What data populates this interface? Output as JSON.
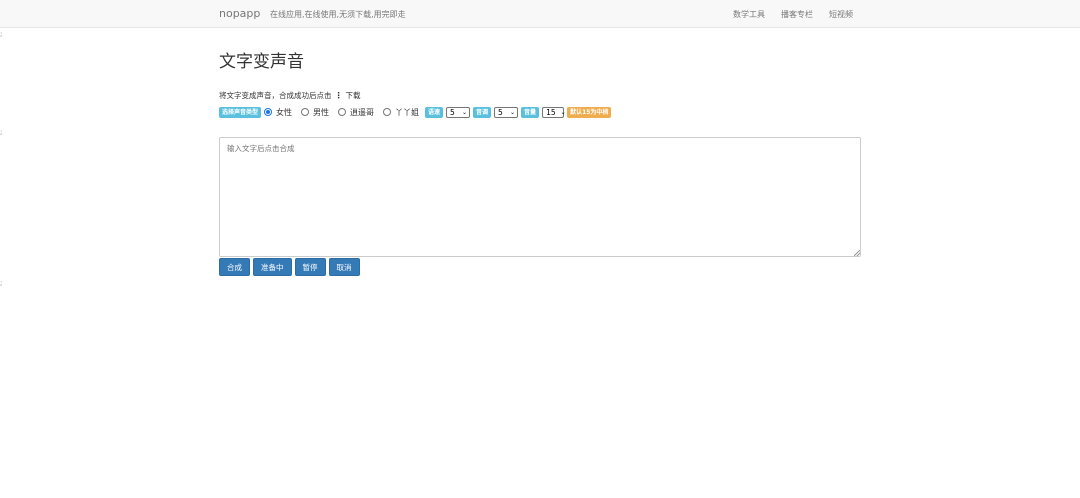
{
  "navbar": {
    "brand": "nopapp",
    "tagline": "在线应用,在线使用,无须下载,用完即走",
    "links": [
      "数学工具",
      "播客专栏",
      "短视频"
    ]
  },
  "edge_marks": [
    ";",
    ";",
    ";"
  ],
  "page": {
    "title": "文字变声音",
    "description_before": "将文字变成声音，合成成功后点击",
    "download_icon": "download-icon",
    "description_after": "下载"
  },
  "options": {
    "voice_type_label": "选择声音类型",
    "voices": [
      {
        "label": "女性",
        "checked": true
      },
      {
        "label": "男性",
        "checked": false
      },
      {
        "label": "逍遥哥",
        "checked": false
      },
      {
        "label": "丫丫姐",
        "checked": false
      }
    ],
    "speed_label": "语速",
    "speed_value": "5",
    "pitch_label": "音调",
    "pitch_value": "5",
    "volume_label": "音量",
    "volume_value": "15",
    "default_label": "默认15为中档"
  },
  "input": {
    "placeholder": "输入文字后点击合成",
    "value": ""
  },
  "buttons": {
    "synthesize": "合成",
    "ready": "准备中",
    "pause": "暂停",
    "cancel": "取消"
  },
  "colors": {
    "primary": "#337ab7",
    "info": "#5bc0de",
    "warning": "#f0ad4e",
    "navbar_bg": "#f8f8f8"
  }
}
